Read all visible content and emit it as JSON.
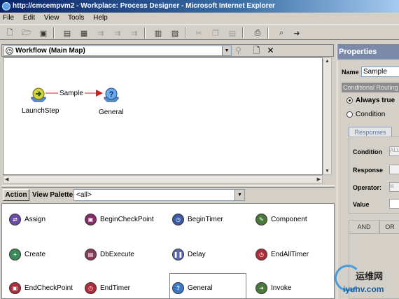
{
  "window": {
    "title": "http://cmcempvm2 - Workplace: Process Designer - Microsoft Internet Explorer"
  },
  "menu": {
    "items": [
      {
        "label": "File"
      },
      {
        "label": "Edit"
      },
      {
        "label": "View"
      },
      {
        "label": "Tools"
      },
      {
        "label": "Help"
      }
    ]
  },
  "toolbar": {
    "icons": [
      "new-icon",
      "open-icon",
      "save-icon",
      "step-icon",
      "add-step-icon",
      "route-icon",
      "route-disabled-icon",
      "route-disabled-icon-2",
      "properties-icon",
      "validate-icon",
      "cut-icon",
      "copy-icon",
      "paste-icon",
      "print-icon",
      "find-icon",
      "go-icon"
    ]
  },
  "workflow": {
    "map_label": "Workflow (Main Map)",
    "nodes": [
      {
        "label": "LaunchStep"
      },
      {
        "label": "General"
      }
    ],
    "route_label": "Sample"
  },
  "palette": {
    "action_label": "Action",
    "view_label": "View Palette:",
    "selected": "<all>",
    "items": [
      {
        "label": "Assign",
        "color": "#6b4aa8"
      },
      {
        "label": "BeginCheckPoint",
        "color": "#8a2a6a"
      },
      {
        "label": "BeginTimer",
        "color": "#3a5aa8"
      },
      {
        "label": "Component",
        "color": "#4a7a3a"
      },
      {
        "label": "Create",
        "color": "#3a8a5a"
      },
      {
        "label": "DbExecute",
        "color": "#8a3a5a"
      },
      {
        "label": "Delay",
        "color": "#5a6ab0"
      },
      {
        "label": "EndAllTimer",
        "color": "#b02a3a"
      },
      {
        "label": "EndCheckPoint",
        "color": "#b02a3a"
      },
      {
        "label": "EndTimer",
        "color": "#b02a3a"
      },
      {
        "label": "General",
        "color": "#3a7ac8"
      },
      {
        "label": "Invoke",
        "color": "#4a7a3a"
      }
    ]
  },
  "properties": {
    "title": "Properties",
    "name_label": "Name",
    "name_value": "Sample",
    "routing_label": "Conditional Routing",
    "always_true": "Always true",
    "condition": "Condition",
    "tab_label": "Responses",
    "fields": [
      {
        "label": "Condition",
        "value": "ALL"
      },
      {
        "label": "Response",
        "value": ""
      },
      {
        "label": "Operator:",
        "value": "is"
      },
      {
        "label": "Value",
        "value": ""
      }
    ],
    "and_label": "AND",
    "or_label": "OR"
  },
  "watermark": {
    "cn": "运维网",
    "en": "iyunv.com"
  }
}
